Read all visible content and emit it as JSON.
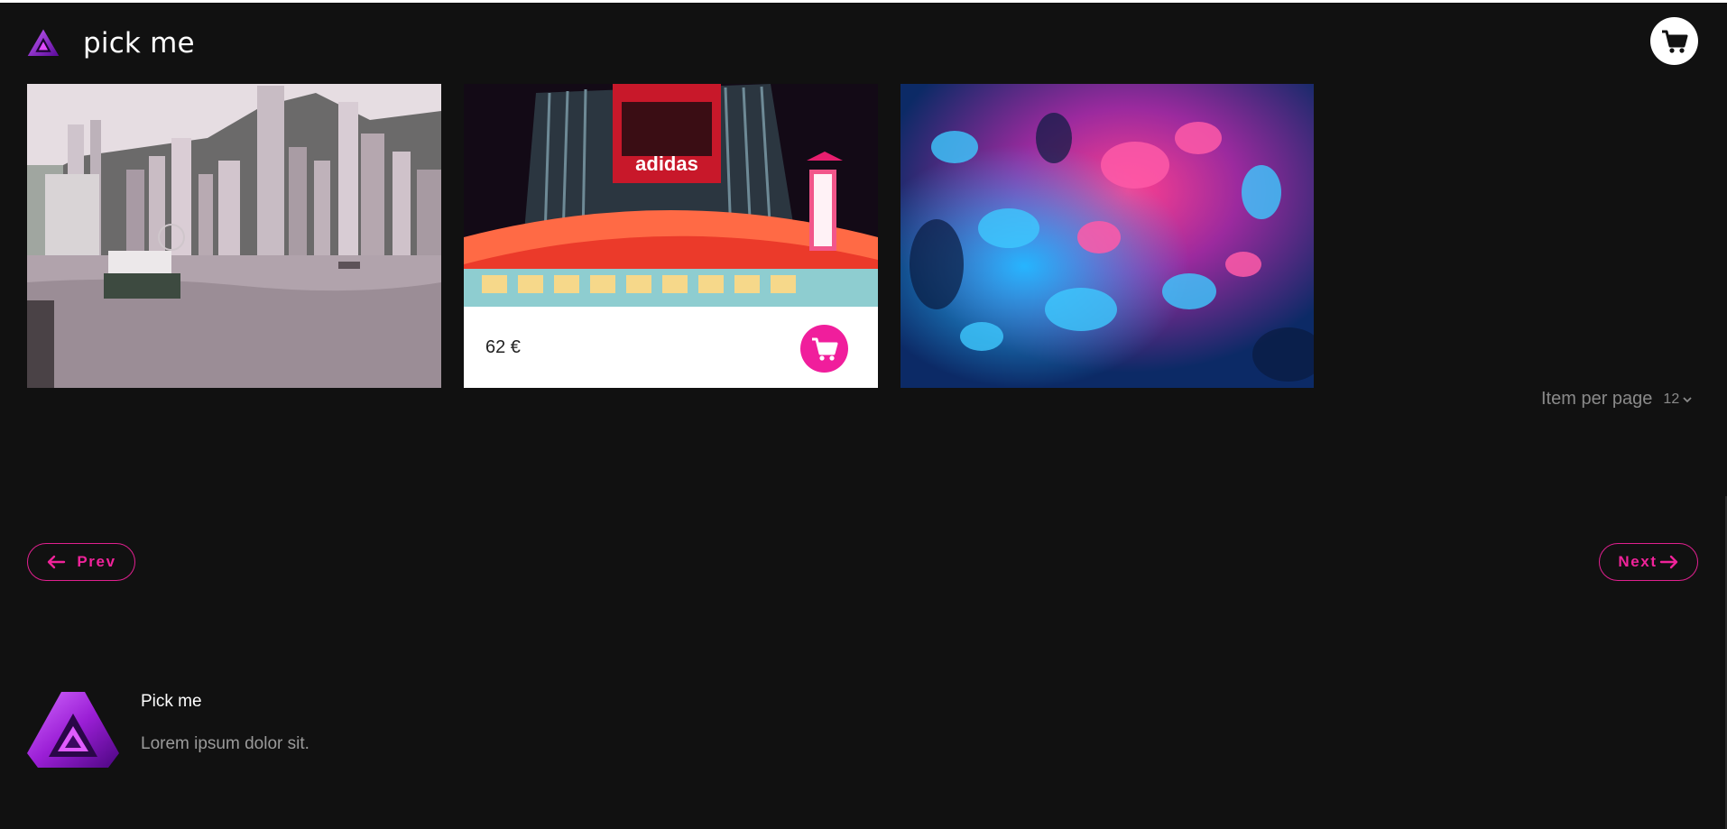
{
  "header": {
    "brand": "pick me",
    "cart_icon": "cart-icon"
  },
  "products": [
    {
      "scene": "harbor-skyline-photo",
      "price": ""
    },
    {
      "scene": "neon-building-photo",
      "price": "62 €",
      "cart_icon": "cart-icon"
    },
    {
      "scene": "blue-pink-water-photo",
      "price": ""
    }
  ],
  "pagination": {
    "per_page_label": "Item per page",
    "per_page_value": "12",
    "prev_label": "Prev",
    "next_label": "Next"
  },
  "footer": {
    "title": "Pick me",
    "text": "Lorem ipsum dolor sit."
  },
  "colors": {
    "background": "#111111",
    "accent": "#f01e9c",
    "logo_purple": "#9b1fd6"
  }
}
